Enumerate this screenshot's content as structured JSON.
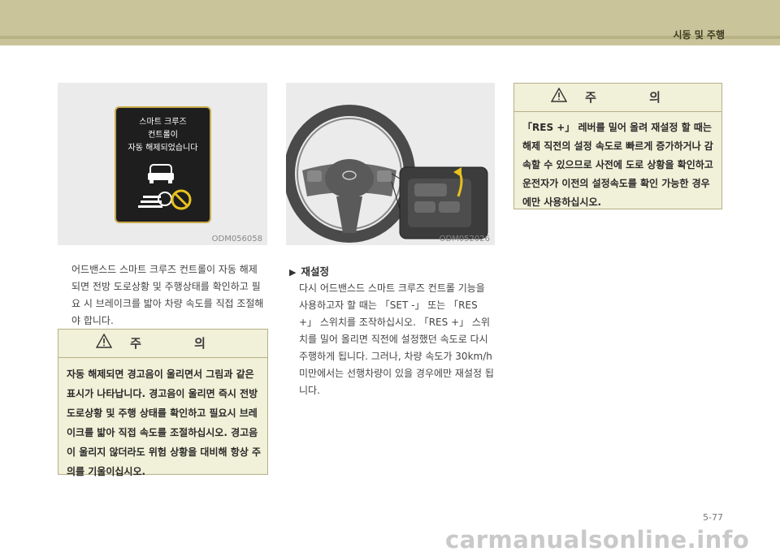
{
  "header": {
    "section_title": "시동 및 주행"
  },
  "figure1": {
    "code": "ODM056058",
    "cluster_message": [
      "스마트 크루즈",
      "컨트롤이",
      "자동 해제되었습니다"
    ]
  },
  "figure2": {
    "code": "ODM052026"
  },
  "left_paragraph": "어드밴스드 스마트 크루즈 컨트롤이 자동 해제되면 전방 도로상황 및 주행상태를 확인하고 필요 시 브레이크를 밟아 차량 속도를 직접 조절해야 합니다.",
  "caution1": {
    "title": "주 의",
    "text": "자동 해제되면 경고음이 울리면서 그림과 같은 표시가 나타납니다. 경고음이 울리면 즉시 전방 도로상황 및 주행 상태를 확인하고 필요시 브레이크를 밟아 직접 속도를 조절하십시오. 경고음이 울리지 않더라도 위험 상황을 대비해 항상 주의를 기울이십시오."
  },
  "resume_section": {
    "heading": "재설정",
    "text": "다시 어드밴스드 스마트 크루즈 컨트롤 기능을 사용하고자 할 때는 「SET -」 또는 「RES +」 스위치를 조작하십시오. 「RES +」 스위치를 밀어 올리면 직전에 설정했던 속도로 다시 주행하게 됩니다. 그러나, 차량 속도가 30km/h 미만에서는 선행차량이 있을 경우에만 재설정 됩니다."
  },
  "caution2": {
    "title": "주 의",
    "text": "「RES +」 레버를 밀어 올려 재설정 할 때는 해제 직전의 설정 속도로 빠르게 증가하거나 감속할 수 있으므로 사전에 도로 상황을 확인하고 운전자가 이전의 설정속도를 확인 가능한 경우에만 사용하십시오."
  },
  "page_number": "5-77",
  "watermark": "carmanualsonline.info"
}
